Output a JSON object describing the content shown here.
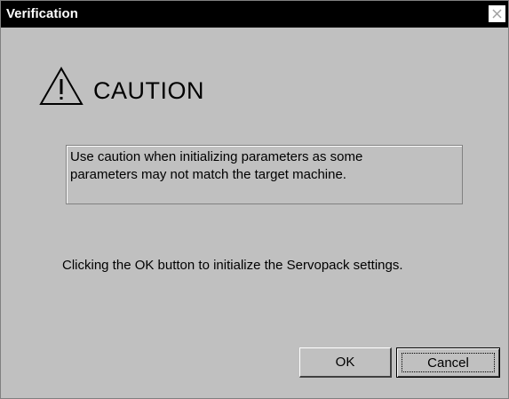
{
  "window": {
    "title": "Verification",
    "close_icon": "close-icon"
  },
  "caution": {
    "icon": "warning-triangle-icon",
    "heading": "CAUTION"
  },
  "message": {
    "line1": "Use caution when initializing parameters as some",
    "line2": "parameters may not match the target machine."
  },
  "info": {
    "text": "Clicking the OK button to initialize the Servopack settings."
  },
  "buttons": {
    "ok_label": "OK",
    "cancel_label": "Cancel"
  },
  "colors": {
    "titlebar": "#000000",
    "dialog_bg": "#c0c0c0",
    "title_text": "#ffffff"
  }
}
